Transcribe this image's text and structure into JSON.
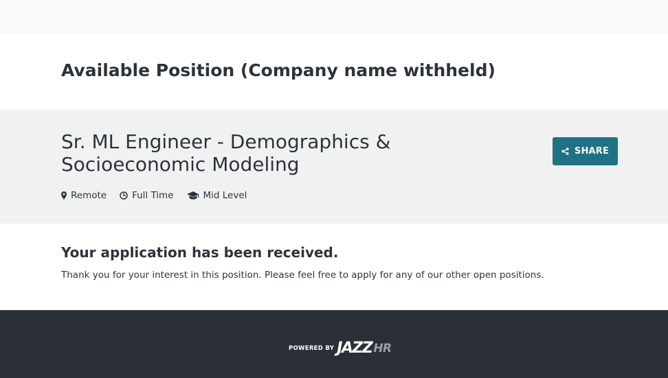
{
  "page": {
    "company_title": "Available Position (Company name withheld)"
  },
  "job": {
    "title": "Sr. ML Engineer - Demographics & Socioeconomic Modeling",
    "share_label": "SHARE",
    "meta": [
      {
        "icon": "map-marker-icon",
        "label": "Remote"
      },
      {
        "icon": "clock-icon",
        "label": "Full Time"
      },
      {
        "icon": "graduation-cap-icon",
        "label": "Mid Level"
      }
    ]
  },
  "confirmation": {
    "title": "Your application has been received.",
    "text": "Thank you for your interest in this position. Please feel free to apply for any of our other open positions."
  },
  "footer": {
    "powered_by": "POWERED BY",
    "logo_text": "JAZZHR"
  },
  "colors": {
    "accent": "#1f7283",
    "footer_bg": "#2b3038",
    "job_header_bg": "#f0f2f2"
  }
}
